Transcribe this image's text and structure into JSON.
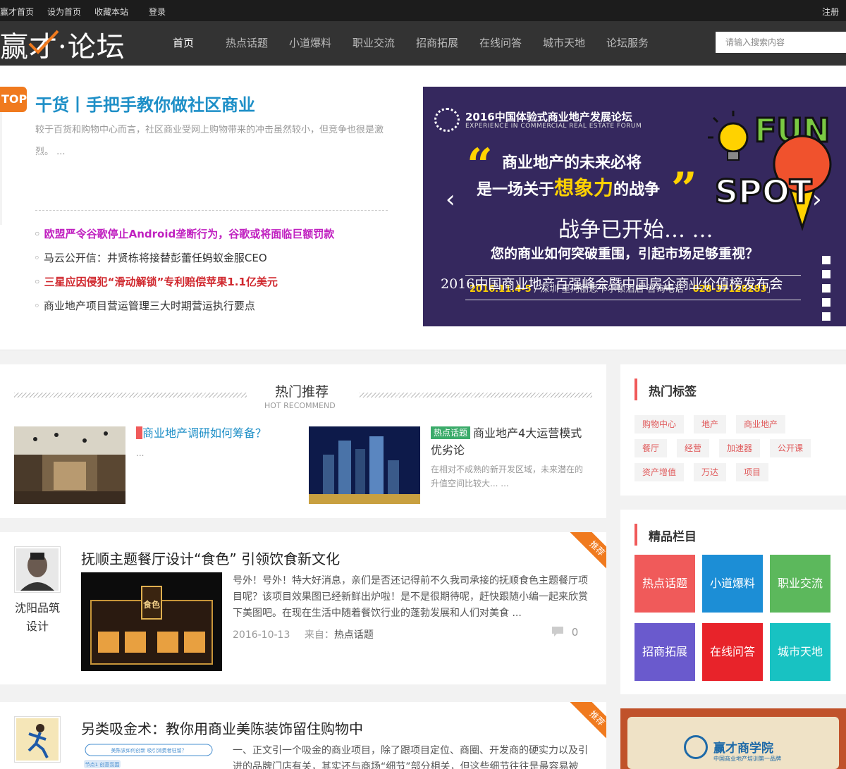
{
  "topbar": {
    "home": "赢才首页",
    "set_home": "设为首页",
    "bookmark": "收藏本站",
    "login": "登录",
    "register": "注册"
  },
  "logo": {
    "text_left": "赢",
    "text_mid": "才",
    "text_right": "·论坛"
  },
  "nav": {
    "items": [
      "首页",
      "热点话题",
      "小道爆料",
      "职业交流",
      "招商拓展",
      "在线问答",
      "城市天地",
      "论坛服务"
    ],
    "search_placeholder": "请输入搜索内容"
  },
  "hero": {
    "badge": "TOP",
    "title": "干货丨手把手教你做社区商业",
    "desc": "较于百货和购物中心而言，社区商业受网上购物带来的冲击虽然较小，但竞争也很是激烈。 ...",
    "news": [
      "欧盟严令谷歌停止Android垄断行为，谷歌或将面临巨额罚款",
      "马云公开信：井贤栋将接替彭蕾任蚂蚁金服CEO",
      "三星应因侵犯“滑动解锁”专利赔偿苹果1.1亿美元",
      "商业地产项目营运管理三大时期营运执行要点"
    ]
  },
  "banner": {
    "forum_title": "2016中国体验式商业地产发展论坛",
    "forum_sub": "EXPERIENCE IN COMMERCIAL REAL ESTATE FORUM",
    "line1": "商业地产的未来必将",
    "line2_pre": "是一场关于",
    "line2_big": "想象力",
    "line2_post": "的战争",
    "line3": "战争已开始… …",
    "line4": "您的商业如何突破重围，引起市场足够重视？",
    "date": "2016.11.4-5",
    "venue": "/ 深圳 星河丽思卡尔顿酒店",
    "phone_label": "咨询电话「",
    "phone": "028-37128283",
    "phone_end": "」",
    "caption": "2016中国商业地产百强峰会暨中国房企商业价值榜发布会",
    "fun": "FUN",
    "spot": "SPOT",
    "prev": "‹",
    "next": "›"
  },
  "recommend": {
    "title": "热门推荐",
    "subtitle": "HOT RECOMMEND",
    "items": [
      {
        "title": "商业地产调研如何筹备？",
        "desc": "..."
      },
      {
        "tag": "热点话题",
        "title": "商业地产4大运营模式优劣论",
        "desc": "在相对不成熟的新开发区域，未来潜在的升值空间比较大... ..."
      }
    ]
  },
  "articles": [
    {
      "ribbon": "推荐",
      "author": "沈阳品筑设计",
      "title": "抚顺主题餐厅设计“食色” 引领饮食新文化",
      "img_sign": "食色",
      "desc": "号外！号外！特大好消息，亲们是否还记得前不久我司承接的抚顺食色主题餐厅项目呢？该项目效果图已经新鲜出炉啦！是不是很期待呢，赶快跟随小编一起来欣赏下美图吧。在现在生活中随着餐饮行业的蓬勃发展和人们对美食 ...",
      "date": "2016-10-13",
      "from_label": "来自：",
      "category": "热点话题",
      "comments": "0"
    },
    {
      "ribbon": "推荐",
      "title": "另类吸金术：教你用商业美陈装饰留住购物中",
      "img_text": "美陈该如何创新 吸引消费者驻留？",
      "img_text2": "节点1 创意氛围",
      "desc": "一、正文引一个吸金的商业项目，除了跟项目定位、商圈、开发商的硬实力以及引进的品牌门店有关，其实还与商场“细节”部分相关，但这些细节往往是最容易被"
    }
  ],
  "sidebar": {
    "tags_title": "热门标签",
    "tags": [
      "购物中心",
      "地产",
      "商业地产",
      "餐厅",
      "经营",
      "加速器",
      "公开课",
      "资产增值",
      "万达",
      "项目"
    ],
    "columns_title": "精品栏目",
    "columns": [
      {
        "label": "热点话题",
        "color": "#f05a5a"
      },
      {
        "label": "小道爆料",
        "color": "#1c8ed6"
      },
      {
        "label": "职业交流",
        "color": "#5cb85c"
      },
      {
        "label": "招商拓展",
        "color": "#6a5acd"
      },
      {
        "label": "在线问答",
        "color": "#e8232a"
      },
      {
        "label": "城市天地",
        "color": "#18c2c2"
      }
    ],
    "ad_title": "赢才商学院",
    "ad_sub": "中国商业地产培训第一品牌"
  }
}
